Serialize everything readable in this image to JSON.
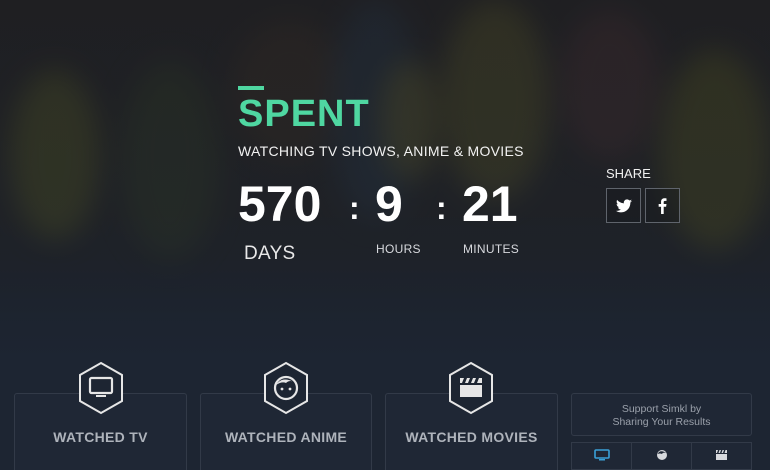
{
  "hero": {
    "title": "SPENT",
    "subtitle": "WATCHING TV SHOWS, ANIME & MOVIES",
    "days_value": "570",
    "days_label": "DAYS",
    "hours_value": "9",
    "hours_label": "HOURS",
    "minutes_value": "21",
    "minutes_label": "MINUTES",
    "separator": ":"
  },
  "share": {
    "label": "SHARE",
    "buttons": [
      {
        "icon": "twitter-icon"
      },
      {
        "icon": "facebook-icon"
      }
    ]
  },
  "cards": [
    {
      "title": "WATCHED TV",
      "icon": "tv-icon"
    },
    {
      "title": "WATCHED ANIME",
      "icon": "anime-face-icon"
    },
    {
      "title": "WATCHED MOVIES",
      "icon": "clapperboard-icon"
    }
  ],
  "support": {
    "line1": "Support Simkl by",
    "line2": "Sharing Your Results",
    "tabs": [
      {
        "icon": "tv-icon",
        "active": true
      },
      {
        "icon": "anime-face-icon",
        "active": false
      },
      {
        "icon": "clapperboard-icon",
        "active": false
      }
    ]
  },
  "colors": {
    "accent": "#4fd7a1",
    "background": "#1d2532",
    "tab_active": "#3aa0d8"
  }
}
